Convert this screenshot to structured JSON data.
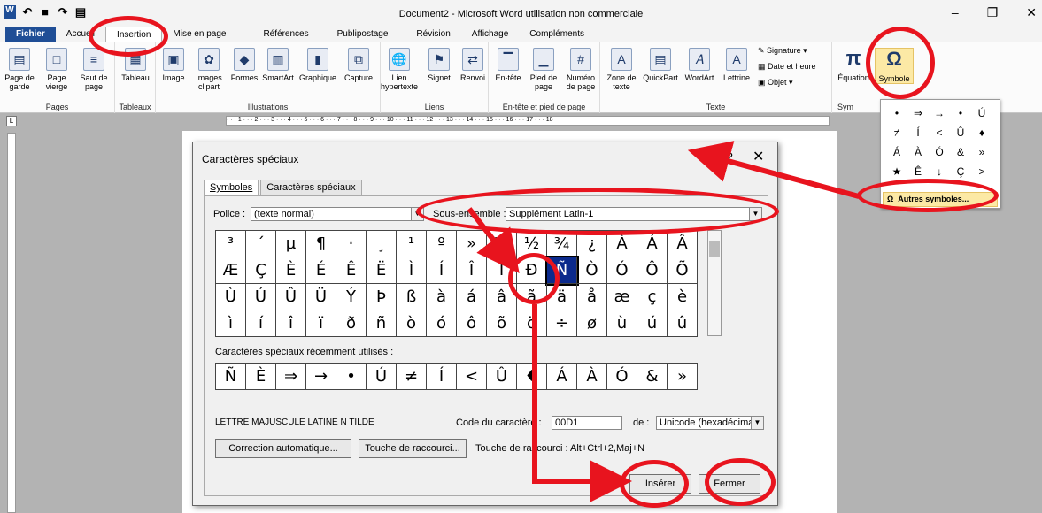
{
  "window": {
    "title": "Document2 - Microsoft Word utilisation non commerciale",
    "controls": [
      "–",
      "❐",
      "✕"
    ]
  },
  "tabs": [
    "Fichier",
    "Accueil",
    "Insertion",
    "Mise en page",
    "Références",
    "Publipostage",
    "Révision",
    "Affichage",
    "Compléments"
  ],
  "ribbon": {
    "groups": [
      {
        "label": "Pages",
        "buttons": [
          "Page de garde",
          "Page vierge",
          "Saut de page"
        ]
      },
      {
        "label": "Tableaux",
        "buttons": [
          "Tableau"
        ]
      },
      {
        "label": "Illustrations",
        "buttons": [
          "Image",
          "Images clipart",
          "Formes",
          "SmartArt",
          "Graphique",
          "Capture"
        ]
      },
      {
        "label": "Liens",
        "buttons": [
          "Lien hypertexte",
          "Signet",
          "Renvoi"
        ]
      },
      {
        "label": "En-tête et pied de page",
        "buttons": [
          "En-tête",
          "Pied de page",
          "Numéro de page"
        ]
      },
      {
        "label": "Texte",
        "buttons": [
          "Zone de texte",
          "QuickPart",
          "WordArt",
          "Lettrine",
          "Signature",
          "Date et heure",
          "Objet"
        ]
      },
      {
        "label": "Sym",
        "buttons": [
          "Équation",
          "Symbole"
        ]
      }
    ]
  },
  "symbol_panel": {
    "symbols": [
      "•",
      "⇒",
      "→",
      "•",
      "Ú",
      "≠",
      "Í",
      "<",
      "Û",
      "♦",
      "Á",
      "À",
      "Ó",
      "&",
      "»",
      "★",
      "Ê",
      "↓",
      "Ç",
      ">"
    ],
    "more": "Autres symboles..."
  },
  "dialog": {
    "title": "Caractères spéciaux",
    "tabs": [
      "Symboles",
      "Caractères spéciaux"
    ],
    "font_label": "Police :",
    "font_value": "(texte normal)",
    "subset_label": "Sous-ensemble :",
    "subset_value": "Supplément Latin-1",
    "chars": [
      "³",
      "´",
      "µ",
      "¶",
      "·",
      "¸",
      "¹",
      "º",
      "»",
      "¼",
      "½",
      "¾",
      "¿",
      "À",
      "Á",
      "Â",
      "Æ",
      "Ç",
      "È",
      "É",
      "Ê",
      "Ë",
      "Ì",
      "Í",
      "Î",
      "Ï",
      "Ð",
      "Ñ",
      "Ò",
      "Ó",
      "Ô",
      "Õ",
      "Ù",
      "Ú",
      "Û",
      "Ü",
      "Ý",
      "Þ",
      "ß",
      "à",
      "á",
      "â",
      "ã",
      "ä",
      "å",
      "æ",
      "ç",
      "è",
      "ì",
      "í",
      "î",
      "ï",
      "ð",
      "ñ",
      "ò",
      "ó",
      "ô",
      "õ",
      "ö",
      "÷",
      "ø",
      "ù",
      "ú",
      "û"
    ],
    "selected_char": "Ñ",
    "recent_label": "Caractères spéciaux récemment utilisés :",
    "recent": [
      "Ñ",
      "È",
      "⇒",
      "→",
      "•",
      "Ú",
      "≠",
      "Í",
      "<",
      "Û",
      "♦",
      "Á",
      "À",
      "Ó",
      "&",
      "»"
    ],
    "char_name": "LETTRE MAJUSCULE LATINE N TILDE",
    "code_label": "Code du caractère :",
    "code_value": "00D1",
    "from_label": "de :",
    "from_value": "Unicode (hexadécimal)",
    "autocorrect": "Correction automatique...",
    "shortcut_btn": "Touche de raccourci...",
    "shortcut_text": "Touche de raccourci : Alt+Ctrl+2,Maj+N",
    "insert": "Insérer",
    "close": "Fermer",
    "help": "?",
    "close_x": "✕"
  }
}
